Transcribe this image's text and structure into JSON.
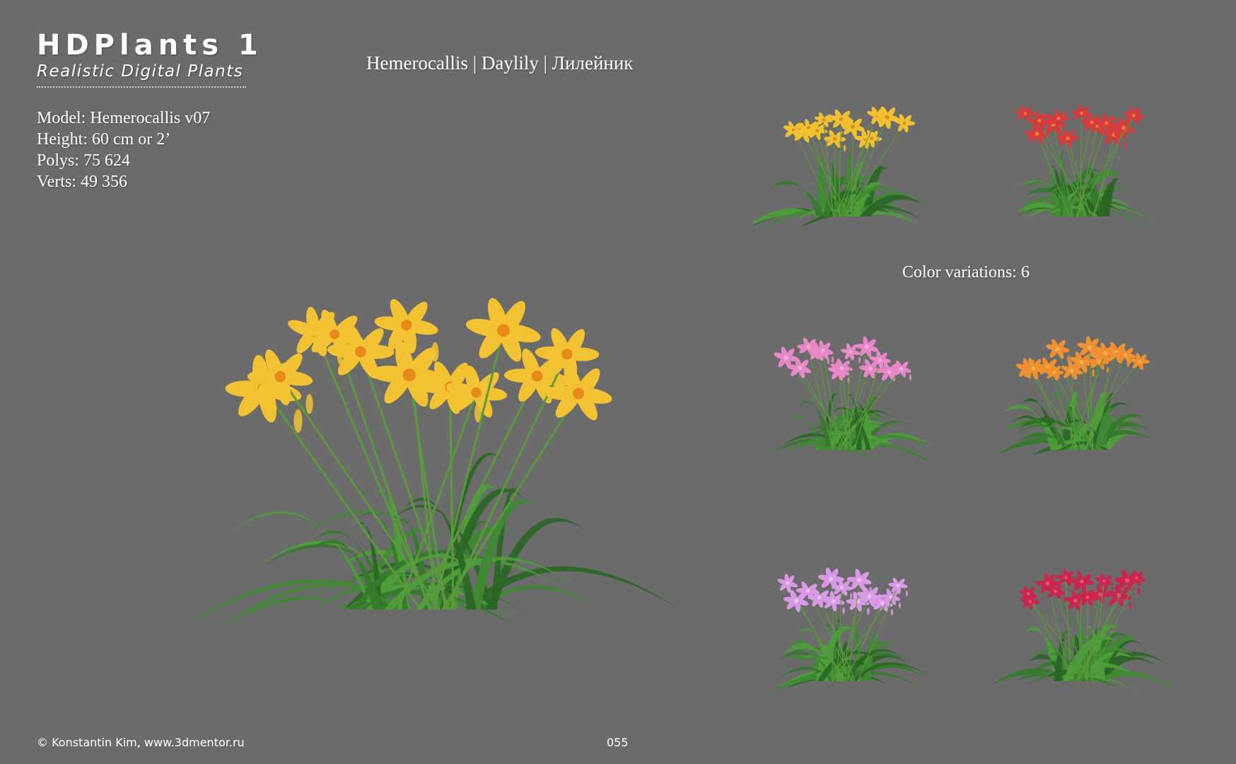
{
  "brand": {
    "title": "HDPlants 1",
    "subtitle": "Realistic Digital Plants"
  },
  "specs": {
    "model": "Model: Hemerocallis v07",
    "height": "Height: 60 cm or 2’",
    "polys": "Polys: 75 624",
    "verts": "Verts: 49 356"
  },
  "page_title": "Hemerocallis | Daylily | Лилейник",
  "color_variations_label": "Color variations: 6",
  "footer": {
    "credit": "© Konstantin Kim, www.3dmentor.ru",
    "page_number": "055"
  },
  "colors": {
    "background": "#6b6b6b",
    "leaf": "#3f8a32",
    "leaf_dark": "#2a6624",
    "stem": "#5a9a3c"
  },
  "main_plant": {
    "flower_color": "#f2c233",
    "flower_center": "#e88a1a"
  },
  "variations": [
    {
      "flower_color": "#f0c030",
      "flower_center": "#e08a20"
    },
    {
      "flower_color": "#d63a3a",
      "flower_center": "#f07a3a"
    },
    {
      "flower_color": "#e888c8",
      "flower_center": "#f0b0d8"
    },
    {
      "flower_color": "#f09030",
      "flower_center": "#f5b050"
    },
    {
      "flower_color": "#d89ae6",
      "flower_center": "#f0c0f0"
    },
    {
      "flower_color": "#c8264e",
      "flower_center": "#e85070"
    }
  ]
}
